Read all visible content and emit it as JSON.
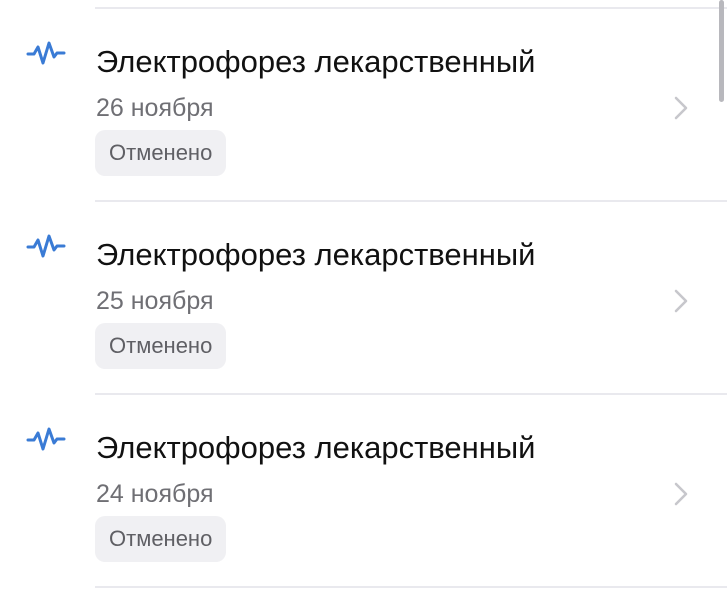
{
  "colors": {
    "icon_accent": "#3a7bd5",
    "title_text": "#111111",
    "date_text": "#6f6f74",
    "badge_bg": "#f0f0f3",
    "badge_text": "#5f5f64",
    "divider": "#e9e9ee",
    "chevron": "#c7c7cc"
  },
  "items": [
    {
      "icon": "waveform-icon",
      "title": "Электрофорез лекарственный",
      "date": "26 ноября",
      "status": "Отменено"
    },
    {
      "icon": "waveform-icon",
      "title": "Электрофорез лекарственный",
      "date": "25 ноября",
      "status": "Отменено"
    },
    {
      "icon": "waveform-icon",
      "title": "Электрофорез лекарственный",
      "date": "24 ноября",
      "status": "Отменено"
    }
  ]
}
